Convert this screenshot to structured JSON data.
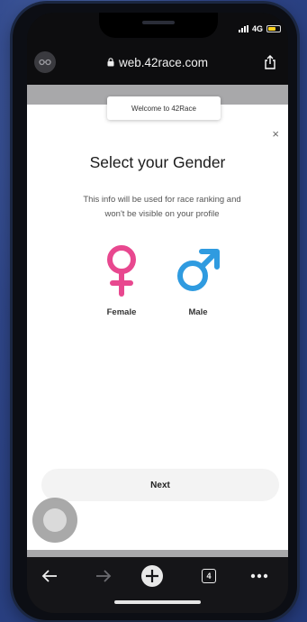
{
  "status_bar": {
    "network": "4G"
  },
  "browser": {
    "url": "web.42race.com"
  },
  "modal": {
    "welcome_tab": "Welcome to 42Race",
    "close_glyph": "×",
    "title": "Select your Gender",
    "info_line1": "This info will be used for race ranking and",
    "info_line2": "won't be visible on your profile",
    "options": [
      {
        "label": "Female",
        "symbol": "♀",
        "color": "#e8488f"
      },
      {
        "label": "Male",
        "symbol": "♂",
        "color": "#2f9be0"
      }
    ],
    "next_label": "Next"
  },
  "toolbar": {
    "tab_count": "4"
  },
  "colors": {
    "battery": "#ffd21f",
    "female": "#e8488f",
    "male": "#2f9be0"
  }
}
